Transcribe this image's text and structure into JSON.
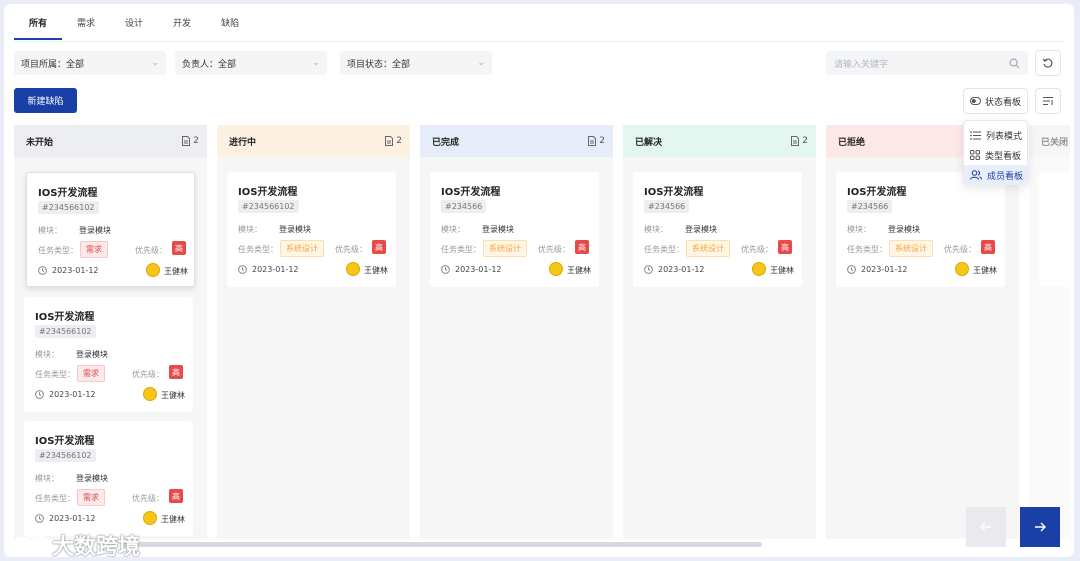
{
  "tabs": [
    "所有",
    "需求",
    "设计",
    "开发",
    "缺陷"
  ],
  "filters": {
    "project": "项目所属：全部",
    "owner": "负责人：全部",
    "status": "项目状态：全部"
  },
  "search": {
    "placeholder": "请输入关键字"
  },
  "new_button": "新建缺陷",
  "view_button": "状态看板",
  "view_menu": [
    "列表模式",
    "类型看板",
    "成员看板"
  ],
  "card_labels": {
    "module": "模块：",
    "type": "任务类型：",
    "priority": "优先级："
  },
  "columns": [
    {
      "title": "未开始",
      "count": "2",
      "color": "#eceef2"
    },
    {
      "title": "进行中",
      "count": "2",
      "color": "#fdf2e2"
    },
    {
      "title": "已完成",
      "count": "2",
      "color": "#e7ecfb"
    },
    {
      "title": "已解决",
      "count": "2",
      "color": "#e3f6ef"
    },
    {
      "title": "已拒绝",
      "count": "",
      "color": "#fde7e7"
    },
    {
      "title": "已关闭",
      "count": "",
      "color": "#eceef2"
    }
  ],
  "cards": [
    {
      "title": "IOS开发流程",
      "code": "#234566102",
      "module": "登录模块",
      "type": "需求",
      "priority": "高",
      "date": "2023-01-12",
      "owner": "王健林"
    },
    {
      "title": "IOS开发流程",
      "code": "#234566102",
      "module": "登录模块",
      "type": "需求",
      "priority": "高",
      "date": "2023-01-12",
      "owner": "王健林"
    },
    {
      "title": "IOS开发流程",
      "code": "#234566102",
      "module": "登录模块",
      "type": "需求",
      "priority": "高",
      "date": "2023-01-12",
      "owner": "王健林"
    },
    {
      "title": "IOS开发流程",
      "code": "#234566102",
      "module": "登录模块",
      "type": "系统设计",
      "priority": "高",
      "date": "2023-01-12",
      "owner": "王健林"
    },
    {
      "title": "IOS开发流程",
      "code": "#234566",
      "module": "登录模块",
      "type": "系统设计",
      "priority": "高",
      "date": "2023-01-12",
      "owner": "王健林"
    },
    {
      "title": "IOS开发流程",
      "code": "#234566",
      "module": "登录模块",
      "type": "系统设计",
      "priority": "高",
      "date": "2023-01-12",
      "owner": "王健林"
    },
    {
      "title": "IOS开发流程",
      "code": "#234566",
      "module": "登录模块",
      "type": "系统设计",
      "priority": "高",
      "date": "2023-01-12",
      "owner": "王健林"
    }
  ],
  "watermark": "大数跨境",
  "colors": {
    "primary": "#1a3fa6",
    "priority": "#e84a4a"
  }
}
